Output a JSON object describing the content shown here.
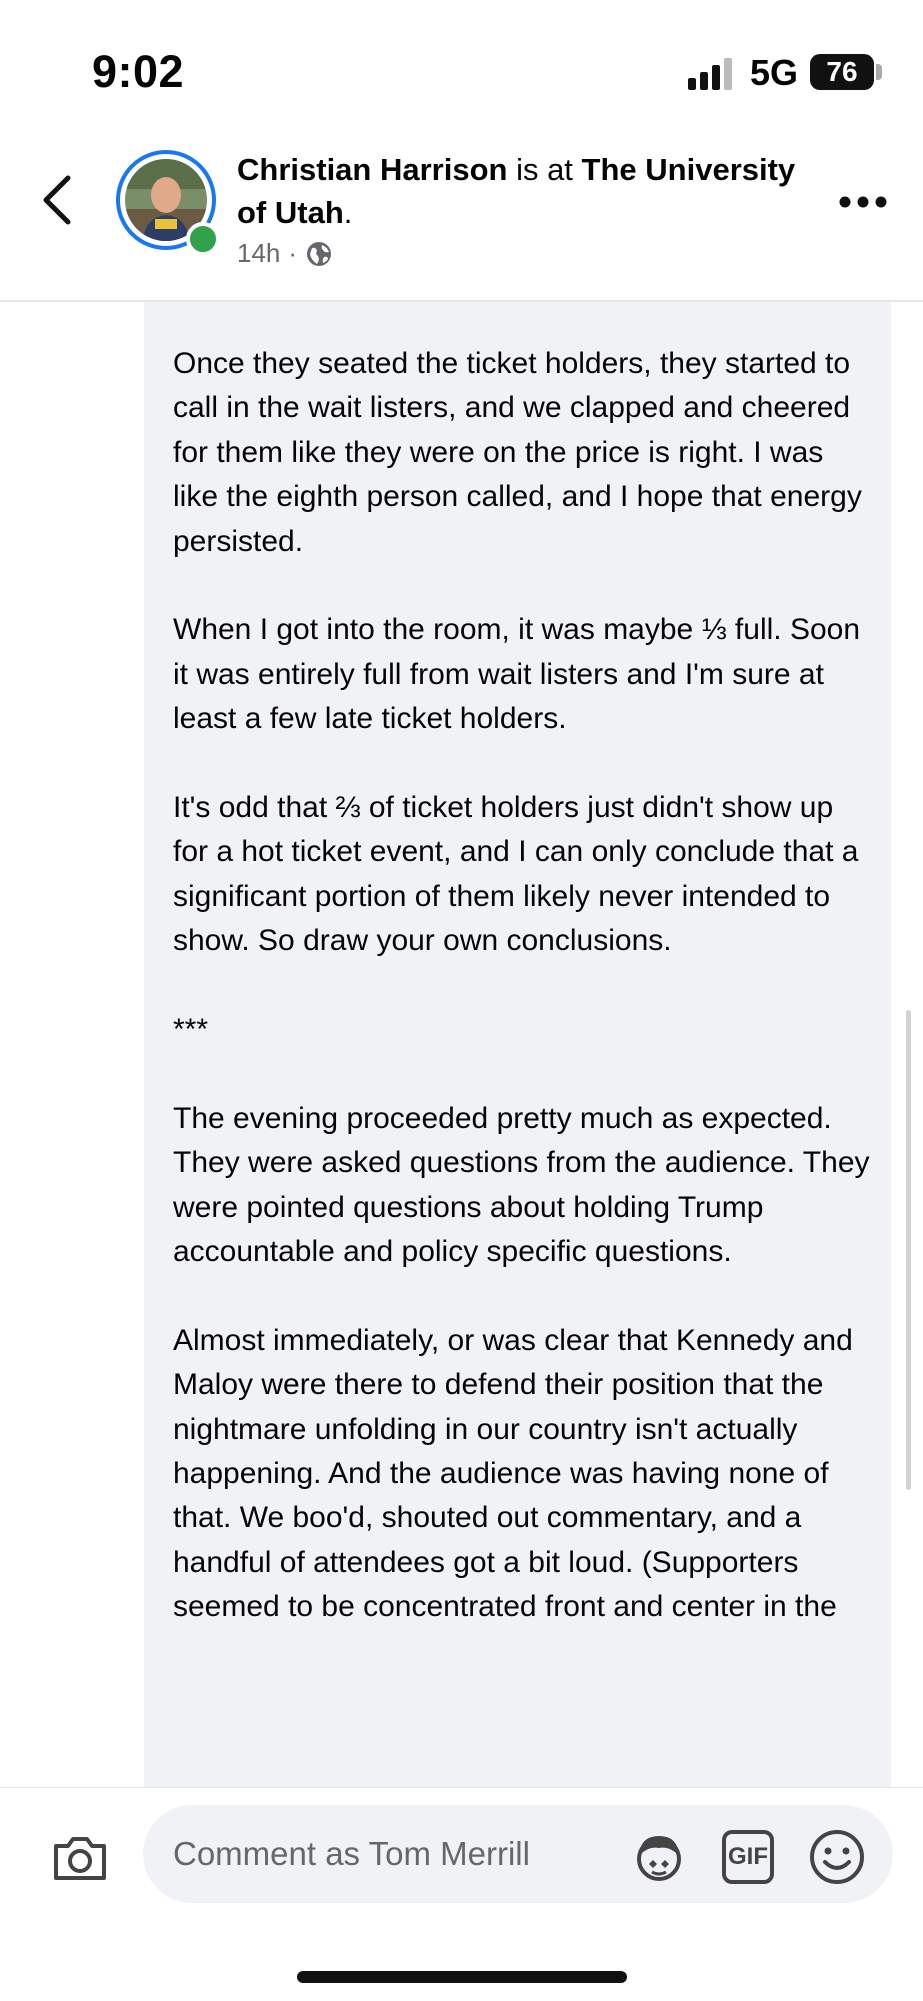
{
  "status_bar": {
    "time": "9:02",
    "network": "5G",
    "battery": "76"
  },
  "header": {
    "author": "Christian Harrison",
    "connector": " is at ",
    "place": "The University of Utah",
    "suffix": ".",
    "timestamp": "14h",
    "separator": "·",
    "privacy_icon": "globe-icon"
  },
  "post": {
    "paragraphs": [
      "Once they seated the ticket holders, they started to call in the wait listers, and we clapped and cheered for them like they were on the price is right. I was like the eighth person called, and I hope that energy persisted.",
      "When I got into the room, it was maybe ⅓ full. Soon it was entirely full from wait listers and I'm sure at least a few late ticket holders.",
      "It's odd that ⅔ of ticket holders just didn't show up for a hot ticket event, and I can only conclude that a significant portion of them likely never intended to show. So draw your own conclusions.",
      "***",
      "The evening proceeded pretty much as expected. They were asked questions from the audience. They were pointed questions about holding Trump accountable and policy specific questions.",
      "Almost immediately, or was clear that Kennedy and Maloy were there to defend their position that the nightmare unfolding in our country isn't actually happening. And the audience was having none of that. We boo'd, shouted out commentary, and a handful of attendees got a bit loud. (Supporters seemed to be concentrated front and center in the"
    ]
  },
  "comment_bar": {
    "placeholder": "Comment as Tom Merrill",
    "gif_label": "GIF"
  },
  "colors": {
    "accent": "#1877f2",
    "online": "#31a24c",
    "panel_bg": "#f0f2f5",
    "muted_text": "#65676b"
  }
}
